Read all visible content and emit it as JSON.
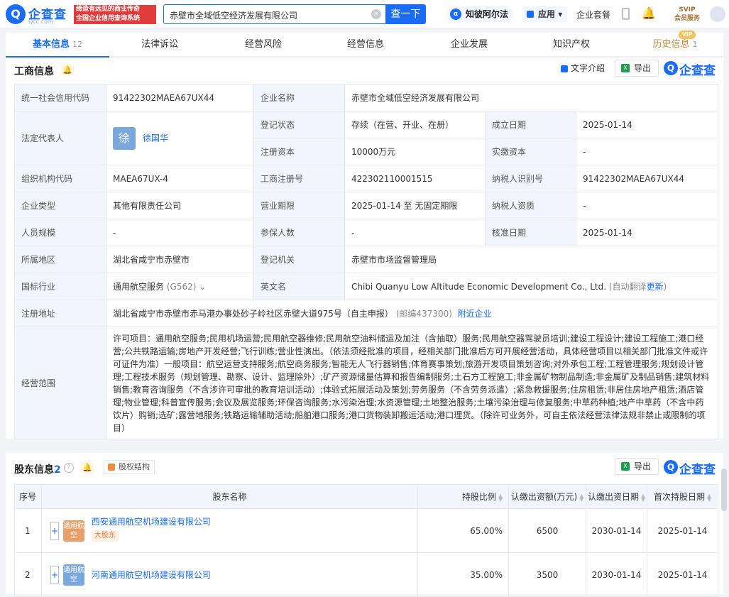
{
  "topbar": {
    "logo_mark": "Q",
    "logo_text": "企查查",
    "logo_sub": "Qcc.com",
    "slogan_line1": "缔造有远见的商业传奇",
    "slogan_line2": "全国企业信用查询系统",
    "search_value": "赤壁市全域低空经济发展有限公司",
    "search_button": "查一下",
    "zhibo_label": "知彼阿尔法",
    "app_label": "应用",
    "suite_label": "企业套餐",
    "vip_line1": "SVIP",
    "vip_line2": "会员服务"
  },
  "tabs": [
    {
      "label": "基本信息",
      "count": "12"
    },
    {
      "label": "法律诉讼"
    },
    {
      "label": "经营风险"
    },
    {
      "label": "经营信息"
    },
    {
      "label": "企业发展"
    },
    {
      "label": "知识产权"
    },
    {
      "label": "历史信息",
      "count": "1"
    }
  ],
  "vip_tag": "VIP",
  "business": {
    "title": "工商信息",
    "text_intro": "文字介绍",
    "export": "导出",
    "brand": "企查查",
    "rows": {
      "credit_code_label": "统一社会信用代码",
      "credit_code": "91422302MAEA67UX44",
      "name_label": "企业名称",
      "name": "赤壁市全域低空经济发展有限公司",
      "legal_label": "法定代表人",
      "legal_avatar": "徐",
      "legal_name": "徐国华",
      "status_label": "登记状态",
      "status": "存续（在营、开业、在册）",
      "found_label": "成立日期",
      "found": "2025-01-14",
      "capital_label": "注册资本",
      "capital": "10000万元",
      "paid_label": "实缴资本",
      "paid": "-",
      "org_label": "组织机构代码",
      "org": "MAEA67UX-4",
      "reg_no_label": "工商注册号",
      "reg_no": "422302110001515",
      "tax_label": "纳税人识别号",
      "tax": "91422302MAEA67UX44",
      "type_label": "企业类型",
      "type": "其他有限责任公司",
      "term_label": "营业期限",
      "term": "2025-01-14 至 无固定期限",
      "taxq_label": "纳税人资质",
      "taxq": "-",
      "staff_label": "人员规模",
      "staff": "-",
      "insured_label": "参保人数",
      "insured": "-",
      "approve_label": "核准日期",
      "approve": "2025-01-14",
      "region_label": "所属地区",
      "region": "湖北省咸宁市赤壁市",
      "authority_label": "登记机关",
      "authority": "赤壁市市场监督管理局",
      "industry_label": "国标行业",
      "industry": "通用航空服务",
      "industry_code": "(G562)",
      "en_label": "英文名",
      "en_name": "Chibi Quanyu Low Altitude Economic Development Co., Ltd.",
      "en_auto": "(自动翻译",
      "en_update": "更新",
      "en_close": ")",
      "address_label": "注册地址",
      "address": "湖北省咸宁市赤壁市赤马港办事处砂子岭社区赤壁大道975号（自主申报）",
      "postcode": "(邮编437300)",
      "nearby": "附近企业",
      "scope_label": "经营范围",
      "scope": "许可项目：通用航空服务;民用机场运营;民用航空器维修;民用航空油料储运及加注（含抽取）服务;民用航空器驾驶员培训;建设工程设计;建设工程施工;港口经营;公共铁路运输;房地产开发经营;飞行训练;营业性演出。（依法须经批准的项目，经相关部门批准后方可开展经营活动，具体经营项目以相关部门批准文件或许可证件为准）一般项目：航空运营支持服务;航空商务服务;智能无人飞行器销售;体育赛事策划;旅游开发项目策划咨询;对外承包工程;工程管理服务;规划设计管理;工程技术服务（规划管理、勘察、设计、监理除外）;矿产资源储量估算和报告编制服务;土石方工程施工;非金属矿物制品制造;非金属矿及制品销售;建筑材料销售;教育咨询服务（不含涉许可审批的教育培训活动）;体验式拓展活动及策划;劳务服务（不含劳务派遣）;紧急救援服务;住房租赁;非居住房地产租赁;酒店管理;物业管理;科普宣传服务;会议及展览服务;环保咨询服务;水污染治理;水资源管理;土地整治服务;土壤污染治理与修复服务;中草药种植;地产中草药（不含中药饮片）购销;选矿;露营地服务;铁路运输辅助活动;船舶港口服务;港口货物装卸搬运活动;港口理货。（除许可业务外，可自主依法经营法律法规非禁止或限制的项目）"
    }
  },
  "shareholders": {
    "title": "股东信息",
    "count": "2",
    "structure_label": "股权结构",
    "export": "导出",
    "brand": "企查查",
    "headers": [
      "序号",
      "股东名称",
      "持股比例",
      "认缴出资额(万元)",
      "认缴出资日期",
      "首次持股日期"
    ],
    "rows": [
      {
        "no": "1",
        "logo": "通用航空",
        "logo_color": "#e8a06a",
        "name": "西安通用航空机场建设有限公司",
        "tag": "大股东",
        "ratio": "65.00%",
        "amount": "6500",
        "date": "2030-01-14",
        "first": "2025-01-14"
      },
      {
        "no": "2",
        "logo": "通用航空",
        "logo_color": "#7aa7dc",
        "name": "河南通用航空机场建设有限公司",
        "tag": "",
        "ratio": "35.00%",
        "amount": "3500",
        "date": "2030-01-14",
        "first": "2025-01-14"
      }
    ]
  }
}
